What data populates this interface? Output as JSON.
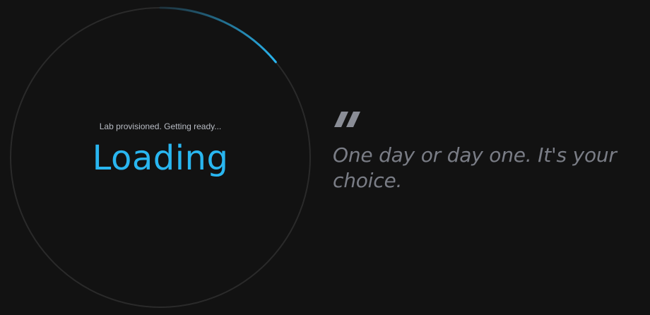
{
  "loader": {
    "status": "Lab provisioned. Getting ready...",
    "label": "Loading",
    "progress": 0.14,
    "accent_color": "#29b6f0",
    "ring_color": "#2a2a2a"
  },
  "quote": {
    "icon": "quote-mark-icon",
    "text": "One day or day one. It's your choice."
  },
  "colors": {
    "background": "#121212",
    "quote_text": "#7a7d86"
  }
}
